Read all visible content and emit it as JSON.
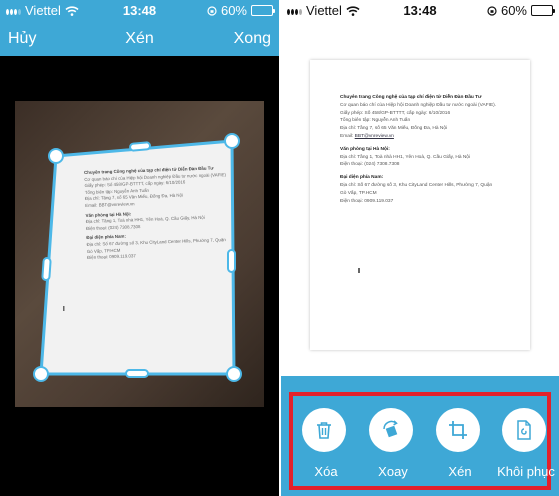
{
  "status_left": {
    "carrier": "Viettel",
    "time": "13:48",
    "battery_text": "60%",
    "battery_level": 0.6
  },
  "status_right": {
    "carrier": "Viettel",
    "time": "13:48",
    "battery_text": "60%",
    "battery_level": 0.6
  },
  "crop_screen": {
    "cancel_label": "Hủy",
    "title": "Xén",
    "done_label": "Xong",
    "header_color": "#3ea8d6",
    "crop_frame_color": "#4db8e8",
    "photo_lines": [
      "Chuyên trang Công nghệ của tạp chí điện tử Diễn Đàn Đầu Tư",
      "Cơ quan báo chí của Hiệp hội Doanh nghiệp Đầu tư nước ngoài (VAFIE)",
      "Giấy phép: Số 458/GP-BTTTT, cấp ngày: 6/10/2016",
      "Tổng biên tập: Nguyễn Anh Tuấn",
      "Địa chỉ: Tầng 7, số 65 Văn Miếu, Đống Đa, Hà Nội",
      "Email: BBT@vnreview.vn",
      "Văn phòng tại Hà Nội:",
      "Địa chỉ: Tầng 1, Toà nhà HH1, Yên Hoà, Q. Cầu Giấy, Hà Nội",
      "Điện thoại: (024) 7308.7308",
      "Đại diện phía Nam:",
      "Địa chỉ: Số 67 đường số 3, Khu CityLand Center Hills, Phường 7, Quận",
      "Gò Vấp, TP.HCM",
      "Điện thoại: 0909.119.037"
    ]
  },
  "preview": {
    "title": "Chuyên trang Công nghệ của tạp chí điện tử Diễn Đàn Đầu Tư",
    "agency": "Cơ quan báo chí của Hiệp hội Doanh nghiệp Đầu tư nước ngoài (VAFIE).",
    "license": "Giấy phép: Số 458/GP-BTTTT, cấp ngày: 6/10/2016",
    "editor": "Tổng biên tập: Nguyễn Anh Tuấn",
    "address": "Địa chỉ: Tầng 7, số 65 Văn Miếu, Đống Đa, Hà Nội",
    "email_label": "Email: ",
    "email": "BBT@vnreview.vn",
    "hanoi_heading": "Văn phòng tại Hà Nội:",
    "hanoi_address": "Địa chỉ: Tầng 1, Toà nhà HH1, Yên Hoà, Q. Cầu Giấy, Hà Nội",
    "hanoi_phone": "Điện thoại: (024) 7308.7308",
    "south_heading": "Đại diện phía Nam:",
    "south_address_1": "Địa chỉ: Số 67 đường số 3, Khu CityLand Center Hills, Phường 7, Quận",
    "south_address_2": "Gò Vấp, TP.HCM",
    "south_phone": "Điện thoại: 0909.119.037"
  },
  "actions": {
    "toolbar_color": "#3ea8d6",
    "highlight_color": "#e2212b",
    "delete_label": "Xóa",
    "rotate_label": "Xoay",
    "crop_label": "Xén",
    "restore_label": "Khôi phục"
  }
}
